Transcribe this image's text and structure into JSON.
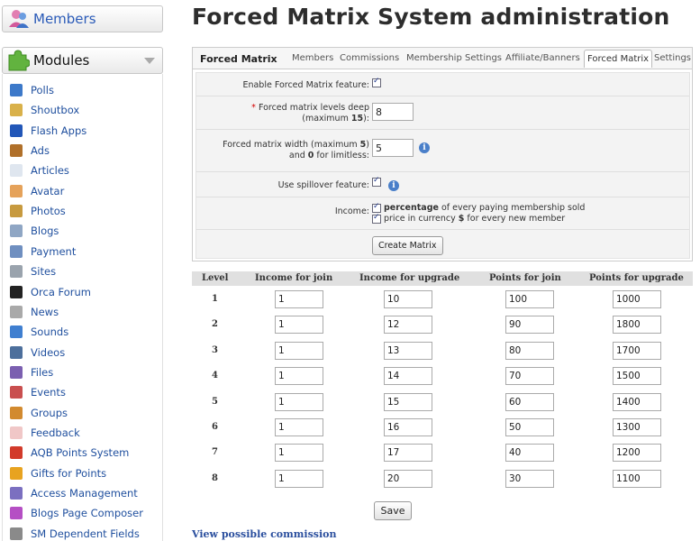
{
  "sidebar": {
    "members_title": "Members",
    "modules_title": "Modules",
    "items": [
      {
        "label": "Polls",
        "icon": "poll-icon",
        "color": "#3d79c9"
      },
      {
        "label": "Shoutbox",
        "icon": "shoutbox-icon",
        "color": "#d9b14a"
      },
      {
        "label": "Flash Apps",
        "icon": "flash-apps-icon",
        "color": "#2257b8"
      },
      {
        "label": "Ads",
        "icon": "ads-icon",
        "color": "#b0702a"
      },
      {
        "label": "Articles",
        "icon": "articles-icon",
        "color": "#dfe6ef"
      },
      {
        "label": "Avatar",
        "icon": "avatar-icon",
        "color": "#e5a25a"
      },
      {
        "label": "Photos",
        "icon": "photos-icon",
        "color": "#c79a3f"
      },
      {
        "label": "Blogs",
        "icon": "blogs-icon",
        "color": "#8fa6c4"
      },
      {
        "label": "Payment",
        "icon": "payment-icon",
        "color": "#6f8fc0"
      },
      {
        "label": "Sites",
        "icon": "sites-icon",
        "color": "#9aa3ad"
      },
      {
        "label": "Orca Forum",
        "icon": "orca-forum-icon",
        "color": "#222222"
      },
      {
        "label": "News",
        "icon": "news-icon",
        "color": "#a9a9a9"
      },
      {
        "label": "Sounds",
        "icon": "sounds-icon",
        "color": "#3f7fd0"
      },
      {
        "label": "Videos",
        "icon": "videos-icon",
        "color": "#4d6f9c"
      },
      {
        "label": "Files",
        "icon": "files-icon",
        "color": "#7b5fb0"
      },
      {
        "label": "Events",
        "icon": "events-icon",
        "color": "#c94f4f"
      },
      {
        "label": "Groups",
        "icon": "groups-icon",
        "color": "#d28a2f"
      },
      {
        "label": "Feedback",
        "icon": "feedback-icon",
        "color": "#f0c7c7"
      },
      {
        "label": "AQB Points System",
        "icon": "points-system-icon",
        "color": "#d23a2a"
      },
      {
        "label": "Gifts for Points",
        "icon": "gifts-icon",
        "color": "#e8a320"
      },
      {
        "label": "Access Management",
        "icon": "access-management-icon",
        "color": "#7b6fc0"
      },
      {
        "label": "Blogs Page Composer",
        "icon": "page-composer-icon",
        "color": "#b54fc4"
      },
      {
        "label": "SM Dependent Fields",
        "icon": "dependent-fields-icon",
        "color": "#8a8a8a"
      }
    ]
  },
  "page": {
    "title": "Forced Matrix System administration"
  },
  "tabs": {
    "title": "Forced Matrix",
    "items": [
      "Members",
      "Commissions",
      "Membership Settings",
      "Affiliate/Banners",
      "Forced Matrix",
      "Settings"
    ]
  },
  "form": {
    "enable_label": "Enable Forced Matrix feature:",
    "levels_star": "*",
    "levels_label_1": "Forced matrix levels deep",
    "levels_label_2a": "(maximum ",
    "levels_label_2b": "15",
    "levels_label_2c": "):",
    "levels_value": "8",
    "width_label_1a": "Forced matrix width (maximum ",
    "width_label_1b": "5",
    "width_label_1c": ")",
    "width_label_2a": "and ",
    "width_label_2b": "0",
    "width_label_2c": " for limitless:",
    "width_value": "5",
    "spillover_label": "Use spillover feature:",
    "income_label": "Income:",
    "income_opt1_bold": "percentage",
    "income_opt1_rest": " of every paying membership sold",
    "income_opt2a": "price in currency ",
    "income_opt2b": "$",
    "income_opt2c": " for every new member",
    "create_button": "Create Matrix",
    "info_glyph": "i"
  },
  "levels": {
    "headers": [
      "Level",
      "Income for join",
      "Income for upgrade",
      "Points for join",
      "Points for upgrade"
    ],
    "rows": [
      {
        "level": "1",
        "income_join": "1",
        "income_upgrade": "10",
        "points_join": "100",
        "points_upgrade": "1000"
      },
      {
        "level": "2",
        "income_join": "1",
        "income_upgrade": "12",
        "points_join": "90",
        "points_upgrade": "1800"
      },
      {
        "level": "3",
        "income_join": "1",
        "income_upgrade": "13",
        "points_join": "80",
        "points_upgrade": "1700"
      },
      {
        "level": "4",
        "income_join": "1",
        "income_upgrade": "14",
        "points_join": "70",
        "points_upgrade": "1500"
      },
      {
        "level": "5",
        "income_join": "1",
        "income_upgrade": "15",
        "points_join": "60",
        "points_upgrade": "1400"
      },
      {
        "level": "6",
        "income_join": "1",
        "income_upgrade": "16",
        "points_join": "50",
        "points_upgrade": "1300"
      },
      {
        "level": "7",
        "income_join": "1",
        "income_upgrade": "17",
        "points_join": "40",
        "points_upgrade": "1200"
      },
      {
        "level": "8",
        "income_join": "1",
        "income_upgrade": "20",
        "points_join": "30",
        "points_upgrade": "1100"
      }
    ]
  },
  "save_button": "Save",
  "view_link": "View possible commission"
}
